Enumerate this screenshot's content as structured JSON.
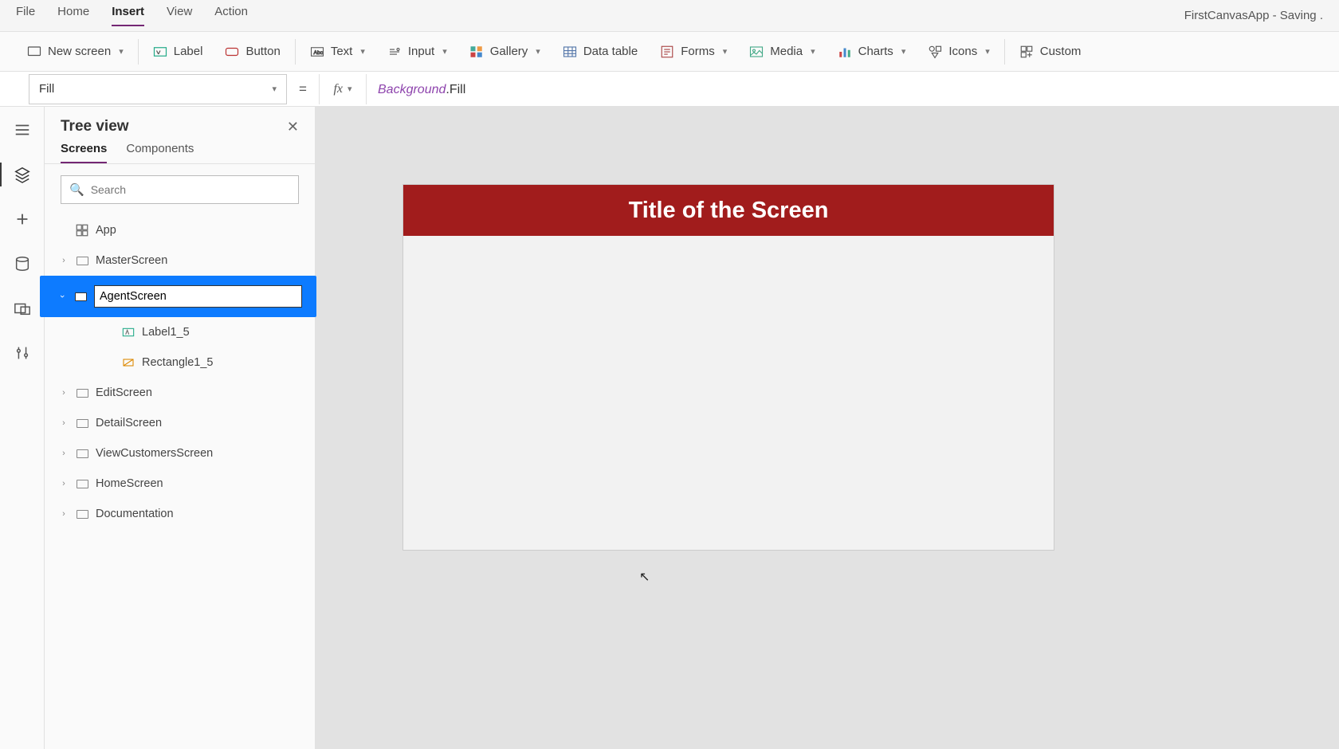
{
  "menubar": {
    "items": [
      "File",
      "Home",
      "Insert",
      "View",
      "Action"
    ],
    "active": "Insert",
    "title": "FirstCanvasApp - Saving ."
  },
  "ribbon": {
    "newScreen": "New screen",
    "label": "Label",
    "button": "Button",
    "text": "Text",
    "input": "Input",
    "gallery": "Gallery",
    "dataTable": "Data table",
    "forms": "Forms",
    "media": "Media",
    "charts": "Charts",
    "icons": "Icons",
    "custom": "Custom"
  },
  "formula": {
    "property": "Fill",
    "fx": "fx",
    "object": "Background",
    "prop": ".Fill"
  },
  "treePanel": {
    "title": "Tree view",
    "tabs": {
      "screens": "Screens",
      "components": "Components"
    },
    "searchPlaceholder": "Search",
    "app": "App",
    "nodes": {
      "master": "MasterScreen",
      "agentEdit": "AgentScreen",
      "label15": "Label1_5",
      "rect15": "Rectangle1_5",
      "edit": "EditScreen",
      "detail": "DetailScreen",
      "viewCustomers": "ViewCustomersScreen",
      "home": "HomeScreen",
      "documentation": "Documentation"
    }
  },
  "canvas": {
    "screenTitle": "Title of the Screen"
  }
}
